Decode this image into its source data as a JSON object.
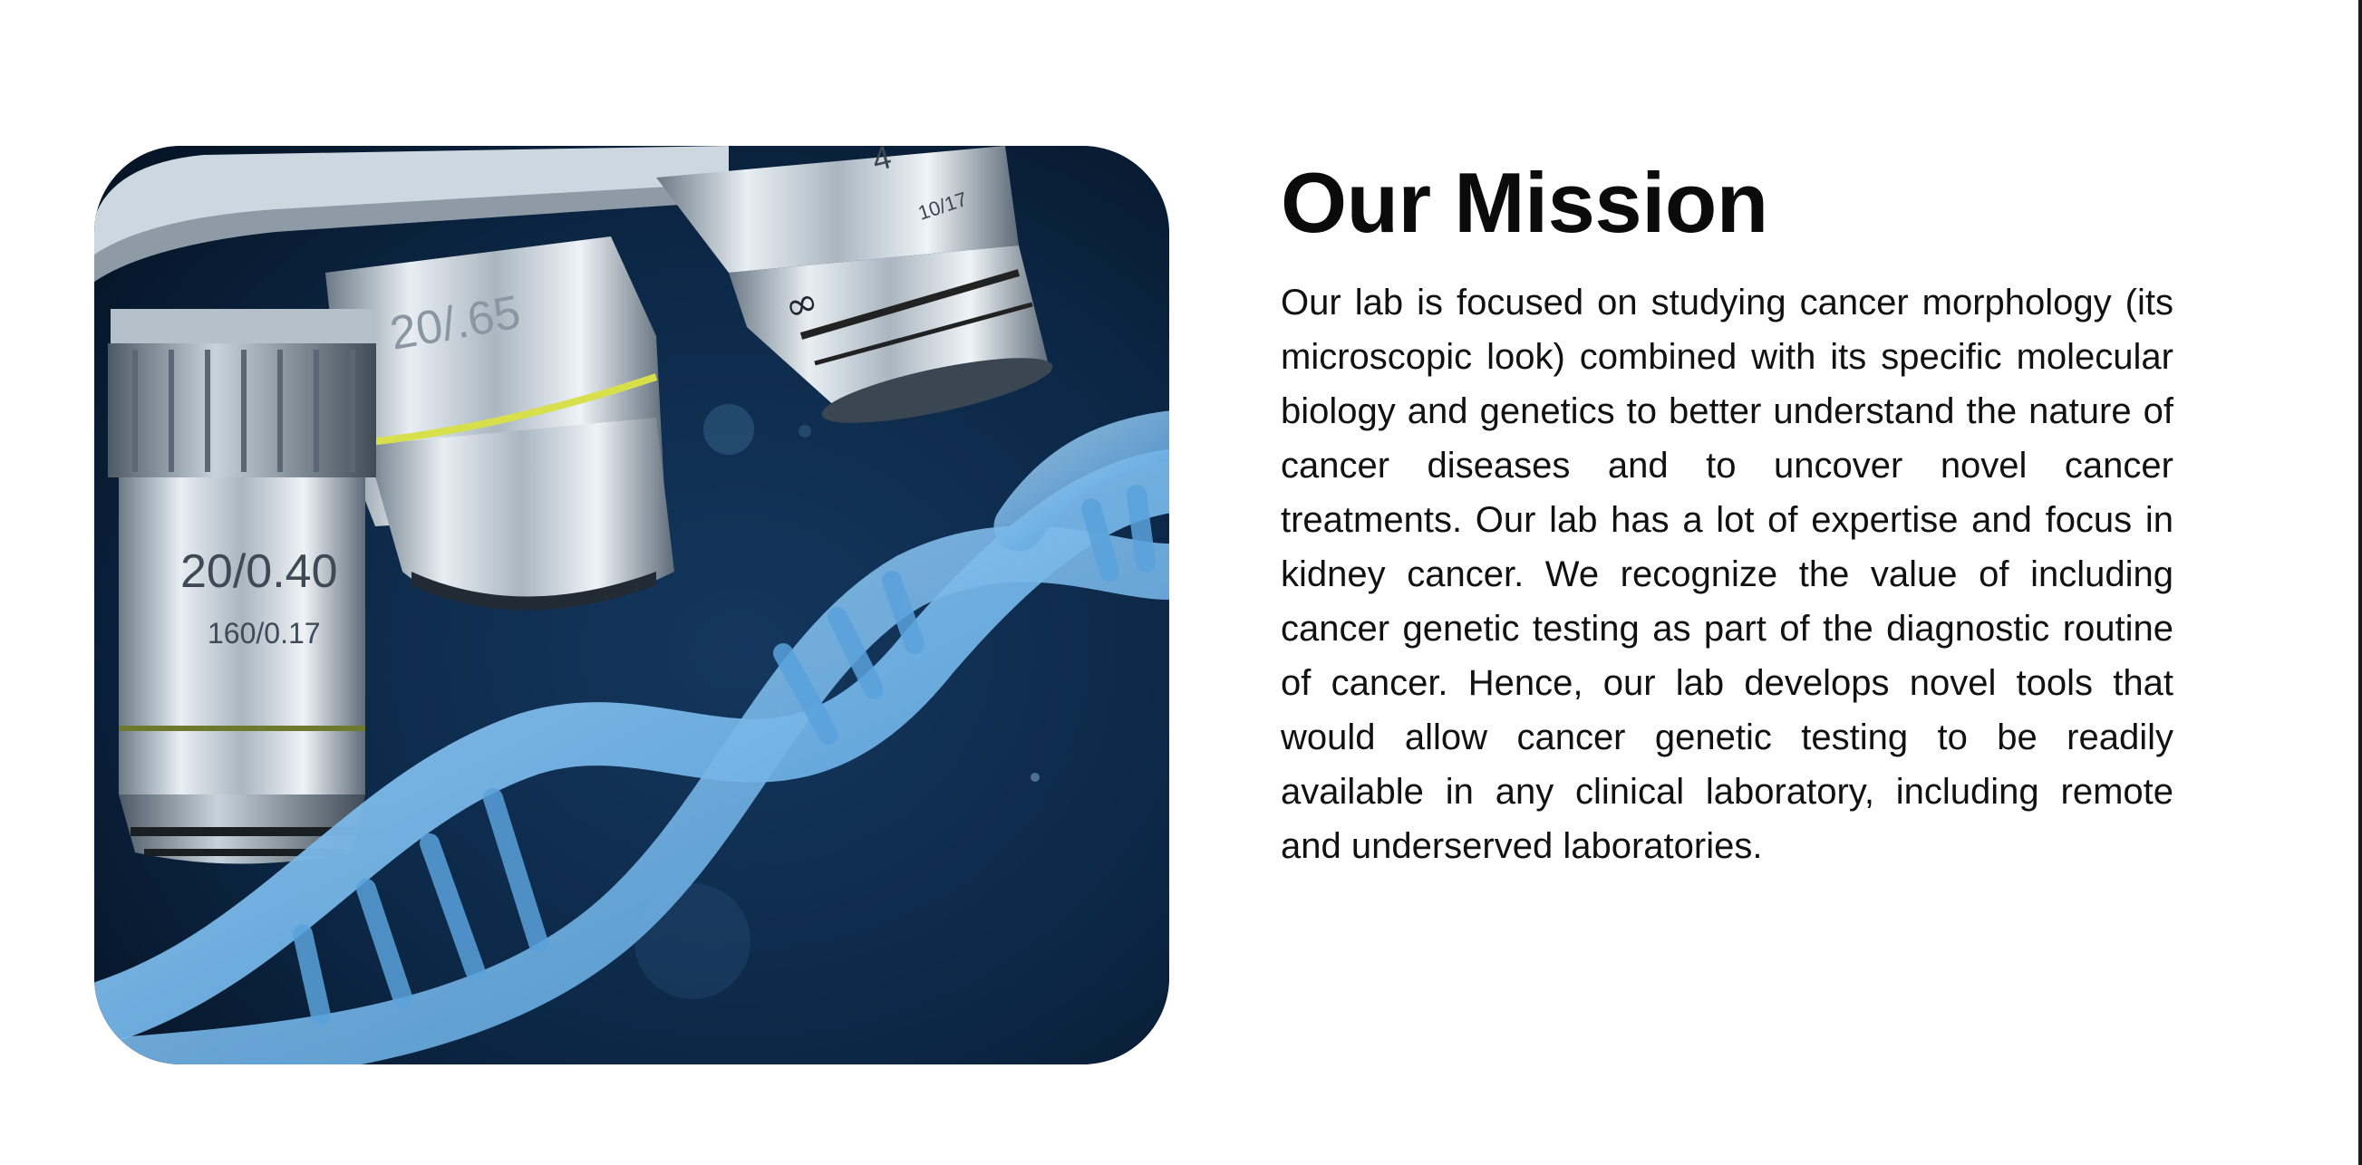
{
  "mission": {
    "title": "Our Mission",
    "body": "Our lab is focused on studying cancer morphology (its microscopic look) combined with its specific molecular biology and genetics to better understand the nature of cancer diseases and to uncover novel cancer treatments. Our lab has a lot of expertise and focus in kidney cancer. We recognize the value of including cancer genetic testing as part of the diagnostic routine of cancer. Hence, our lab develops novel tools that would allow cancer genetic testing to be readily available in any clinical laboratory, including remote and underserved laboratories."
  },
  "image": {
    "objective_main_label": "20/0.40",
    "objective_main_sub": "160/0.17",
    "objective_back_label": "20/.65",
    "objective_right_label": "4",
    "objective_right_sub": "10/17",
    "infinity_mark": "∞"
  },
  "colors": {
    "background": "#ffffff",
    "heading": "#0b0b0b",
    "body_text": "#111111",
    "image_bg": "#0a2340",
    "dna_blue": "#6fb3ea"
  }
}
